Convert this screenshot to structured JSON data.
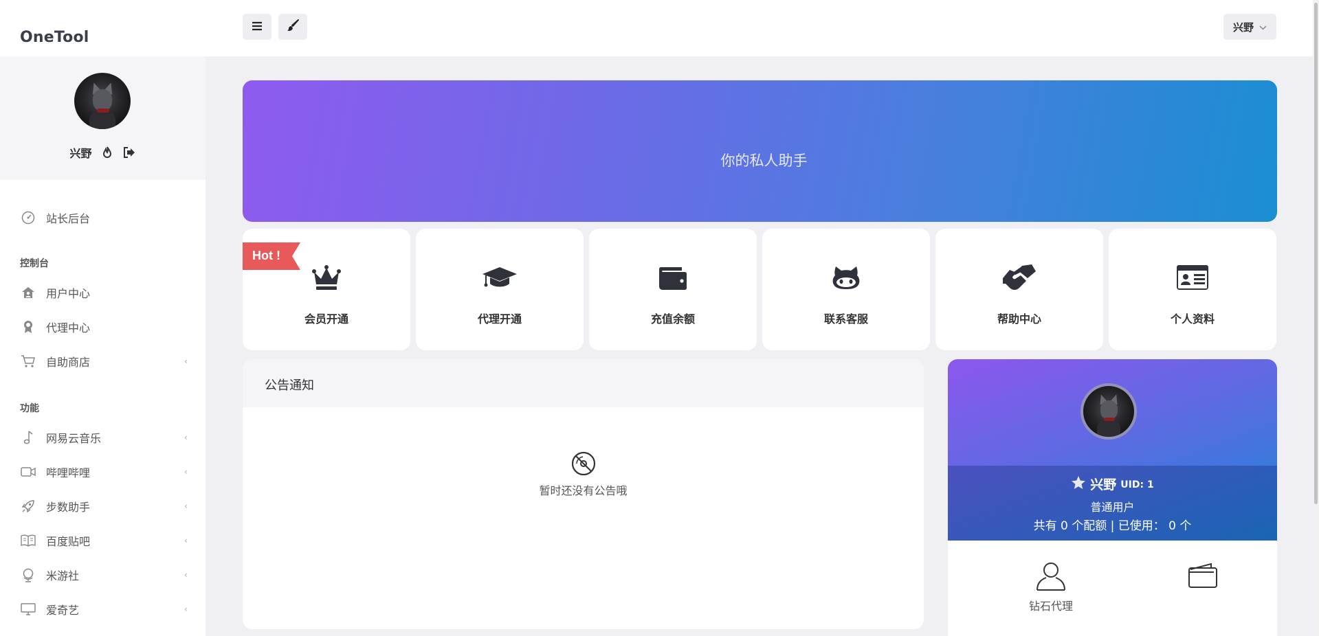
{
  "app": {
    "title": "OneTool"
  },
  "sidebar": {
    "user_name": "兴野",
    "sections": [
      {
        "heading": "",
        "items": [
          {
            "label": "站长后台",
            "icon": "dashboard-gauge-icon",
            "has_arrow": false
          }
        ]
      },
      {
        "heading": "控制台",
        "items": [
          {
            "label": "用户中心",
            "icon": "home-user-icon",
            "has_arrow": false
          },
          {
            "label": "代理中心",
            "icon": "award-badge-icon",
            "has_arrow": false
          },
          {
            "label": "自助商店",
            "icon": "shopping-cart-icon",
            "has_arrow": true
          }
        ]
      },
      {
        "heading": "功能",
        "items": [
          {
            "label": "网易云音乐",
            "icon": "music-note-icon",
            "has_arrow": true
          },
          {
            "label": "哔哩哔哩",
            "icon": "video-camera-icon",
            "has_arrow": true
          },
          {
            "label": "步数助手",
            "icon": "rocket-icon",
            "has_arrow": true
          },
          {
            "label": "百度贴吧",
            "icon": "book-open-icon",
            "has_arrow": true
          },
          {
            "label": "米游社",
            "icon": "globe-stand-icon",
            "has_arrow": true
          },
          {
            "label": "爱奇艺",
            "icon": "monitor-icon",
            "has_arrow": true
          }
        ]
      }
    ]
  },
  "topbar": {
    "user_label": "兴野"
  },
  "banner": {
    "text": "你的私人助手"
  },
  "quick": [
    {
      "label": "会员开通",
      "icon": "crown-icon"
    },
    {
      "label": "代理开通",
      "icon": "graduation-cap-icon"
    },
    {
      "label": "充值余额",
      "icon": "wallet-icon"
    },
    {
      "label": "联系客服",
      "icon": "github-cat-icon"
    },
    {
      "label": "帮助中心",
      "icon": "handshake-icon"
    },
    {
      "label": "个人资料",
      "icon": "id-card-icon"
    }
  ],
  "hot_badge": "Hot !",
  "notice": {
    "title": "公告通知",
    "empty_text": "暂时还没有公告哦"
  },
  "user_card": {
    "name": "兴野",
    "uid": "UID: 1",
    "role": "普通用户",
    "quota_text": "共有 0 个配额 | 已使用： 0 个",
    "actions": [
      {
        "label": "钻石代理",
        "icon": "user-outline-icon"
      },
      {
        "label": "",
        "icon": "wallet-outline-icon"
      }
    ]
  },
  "colors": {
    "accent_start": "#8e5bef",
    "accent_end": "#1a8ed2",
    "hot": "#e85a5a",
    "text": "#333333"
  }
}
